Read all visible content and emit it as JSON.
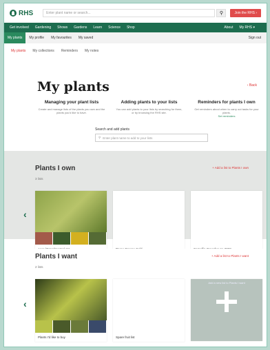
{
  "header": {
    "logo_text": "RHS",
    "search_placeholder": "Enter plant name or search...",
    "join_label": "Join the RHS ›"
  },
  "mainnav": {
    "items": [
      "Get involved",
      "Gardening",
      "Shows",
      "Gardens",
      "Learn",
      "Science",
      "Shop"
    ],
    "right": [
      "About",
      "My RHS ▾"
    ]
  },
  "subnav": {
    "tabs": [
      "My plants",
      "My profile",
      "My favourites",
      "My saved"
    ],
    "signout": "Sign out"
  },
  "quicklinks": [
    "My plants",
    "My collections",
    "Reminders",
    "My notes"
  ],
  "page": {
    "title": "My plants",
    "back_label": "‹ Back"
  },
  "intro": [
    {
      "title": "Managing your plant lists",
      "text": "Create and manage lists of the plants you own and the plants you'd like to have."
    },
    {
      "title": "Adding plants to your lists",
      "text": "You can add plants to your lists by searching for them, or by browsing the RHS site."
    },
    {
      "title": "Reminders for plants I own",
      "text": "Get reminders about when to carry out tasks for your plants.",
      "link": "Set reminders"
    }
  ],
  "search_add": {
    "label": "Search and add plants",
    "placeholder": "Enter plant name to add to your lists"
  },
  "own": {
    "title": "Plants I own",
    "count": "3 lists",
    "add_label": "+ Add a list to Plants I own",
    "cards": [
      {
        "caption": "Acer (Grandmaster) 24",
        "colors": [
          "#8da34a",
          "#b8c46a",
          "#5f7a2c",
          "#7e9a3a",
          "#4c6b2b"
        ]
      },
      {
        "caption": "Prune Greeny Cold",
        "colors": [
          "#a8416a",
          "#c95d88",
          "#6c8a4a",
          "#8d6a7a",
          "#b06a4a"
        ]
      },
      {
        "caption": "Camellia Greenhouse 2022",
        "colors": [
          "#4a7a3a",
          "#a35a4a",
          "#3c5c2c",
          "#d3b020",
          "#556b35"
        ]
      }
    ]
  },
  "want": {
    "title": "Plants I want",
    "count": "2 lists",
    "add_label": "+ Add a list to Plants I want",
    "cards": [
      {
        "caption": "Plants I'd like to buy",
        "colors": [
          "#2d3b18",
          "#b8c24a",
          "#4a5a2a",
          "#6a7a3a",
          "#3a4a6a"
        ]
      },
      {
        "caption": "Spare fruit list",
        "colors": [
          "#8a4a9a",
          "#b070c0",
          "#6a3a7a",
          "#9a5aaa",
          "#7a4a8a"
        ]
      }
    ],
    "add_card_caption": "Add a new list to Plants I want"
  },
  "colors": {
    "brand": "#1d6d4f",
    "accent": "#e04b4b",
    "active_tab": "#2a8a5e"
  }
}
